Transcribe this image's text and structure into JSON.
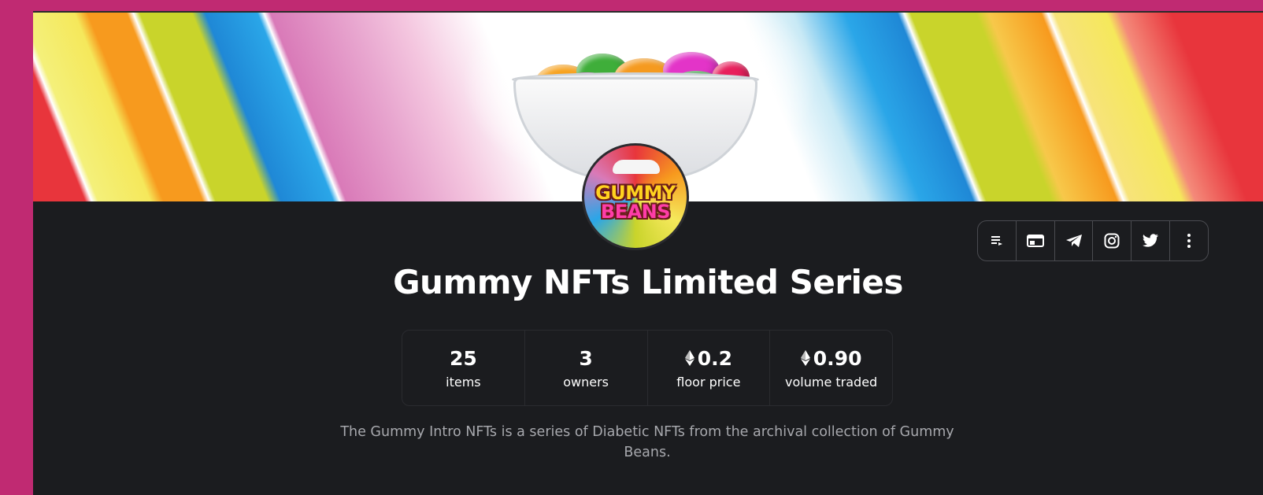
{
  "collection": {
    "title": "Gummy NFTs Limited Series",
    "avatar_text_line1": "GUMMY",
    "avatar_text_line2": "BEANS",
    "description": "The Gummy Intro NFTs is a series of Diabetic NFTs from the archival collection of Gummy Beans."
  },
  "stats": [
    {
      "value": "25",
      "label": "items",
      "currency_icon": false
    },
    {
      "value": "3",
      "label": "owners",
      "currency_icon": false
    },
    {
      "value": "0.2",
      "label": "floor price",
      "currency_icon": "ethereum-icon"
    },
    {
      "value": "0.90",
      "label": "volume traded",
      "currency_icon": "ethereum-icon"
    }
  ],
  "action_icons": [
    "activity-icon",
    "website-icon",
    "telegram-icon",
    "instagram-icon",
    "twitter-icon",
    "more-icon"
  ],
  "colors": {
    "page_bg": "#1b1c1f",
    "outer_bg": "#c02a72",
    "text_primary": "#ffffff",
    "text_secondary": "#a7a8ad"
  }
}
